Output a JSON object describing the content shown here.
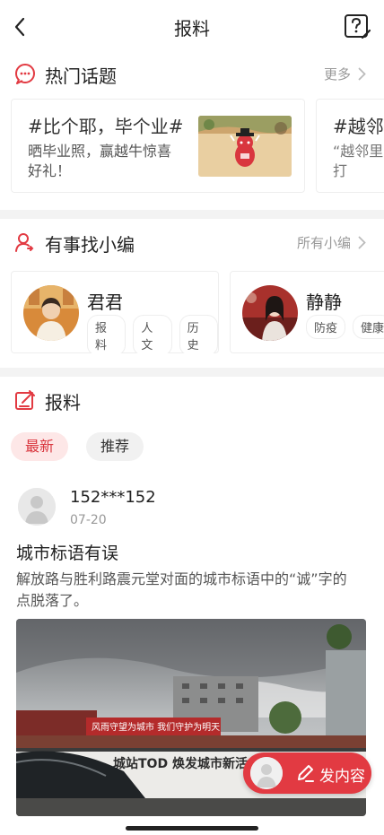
{
  "header": {
    "title": "报料"
  },
  "hot_topics": {
    "title": "热门话题",
    "more_label": "更多",
    "cards": [
      {
        "title": "#比个耶，毕个业#",
        "desc": "晒毕业照，赢越牛惊喜好礼！"
      },
      {
        "title": "#越邻",
        "desc": "“越邻里中心打"
      }
    ]
  },
  "find_editor": {
    "title": "有事找小编",
    "more_label": "所有小编",
    "editors": [
      {
        "name": "君君",
        "tags": [
          "报料",
          "人文",
          "历史"
        ]
      },
      {
        "name": "静静",
        "tags": [
          "防疫",
          "健康"
        ]
      }
    ]
  },
  "report": {
    "title": "报料",
    "tabs": [
      {
        "label": "最新",
        "active": true
      },
      {
        "label": "推荐",
        "active": false
      }
    ],
    "post": {
      "user": "152***152",
      "date": "07-20",
      "title": "城市标语有误",
      "body": "解放路与胜利路震元堂对面的城市标语中的“诚”字的点脱落了。",
      "photo_banner_text": "风雨守望为城市 我们守护为明天",
      "photo_wall_text": "城站TOD 焕发城市新活力"
    }
  },
  "fab": {
    "label": "发内容"
  },
  "colors": {
    "accent": "#e23a42",
    "tab_active_bg": "#fde7e7"
  }
}
